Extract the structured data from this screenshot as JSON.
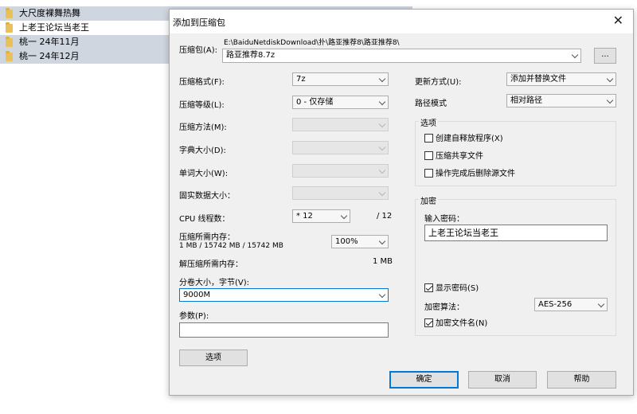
{
  "background_list": {
    "items": [
      {
        "label": "大尺度裸舞热舞"
      },
      {
        "label": "上老王论坛当老王"
      },
      {
        "label": "桃一 24年11月"
      },
      {
        "label": "桃一 24年12月"
      }
    ]
  },
  "dialog": {
    "title": "添加到压缩包",
    "archive": {
      "label": "压缩包(A):",
      "path": "E:\\BaiduNetdiskDownload\\扑\\路亚推荐8\\路亚推荐8\\",
      "filename": "路亚推荐8.7z",
      "browse_label": "..."
    },
    "left": {
      "format": {
        "label": "压缩格式(F):",
        "value": "7z"
      },
      "level": {
        "label": "压缩等级(L):",
        "value": "0 - 仅存储"
      },
      "method": {
        "label": "压缩方法(M):",
        "value": ""
      },
      "dict_size": {
        "label": "字典大小(D):",
        "value": ""
      },
      "word_size": {
        "label": "单词大小(W):",
        "value": ""
      },
      "solid_size": {
        "label": "固实数据大小：",
        "value": ""
      },
      "cpu_threads": {
        "label": "CPU 线程数：",
        "value": "* 12",
        "max": "/ 12"
      },
      "mem_compress": {
        "label": "压缩所需内存：",
        "detail": "1 MB / 15742 MB / 15742 MB",
        "value": "100%"
      },
      "mem_decompress": {
        "label": "解压缩所需内存：",
        "value": "1 MB"
      },
      "split": {
        "label": "分卷大小，字节(V):",
        "value": "9000M"
      },
      "params": {
        "label": "参数(P):",
        "value": ""
      },
      "options_button": "选项"
    },
    "right": {
      "update_mode": {
        "label": "更新方式(U):",
        "value": "添加并替换文件"
      },
      "path_mode": {
        "label": "路径模式",
        "value": "相对路径"
      },
      "options_group": {
        "title": "选项",
        "sfx": {
          "label": "创建自释放程序(X)",
          "checked": false
        },
        "shared": {
          "label": "压缩共享文件",
          "checked": false
        },
        "delete_after": {
          "label": "操作完成后删除源文件",
          "checked": false
        }
      },
      "encryption_group": {
        "title": "加密",
        "password_label": "输入密码：",
        "password_value": "上老王论坛当老王",
        "show_password": {
          "label": "显示密码(S)",
          "checked": true
        },
        "method": {
          "label": "加密算法：",
          "value": "AES-256"
        },
        "encrypt_names": {
          "label": "加密文件名(N)",
          "checked": true
        }
      }
    },
    "buttons": {
      "ok": "确定",
      "cancel": "取消",
      "help": "帮助"
    }
  }
}
